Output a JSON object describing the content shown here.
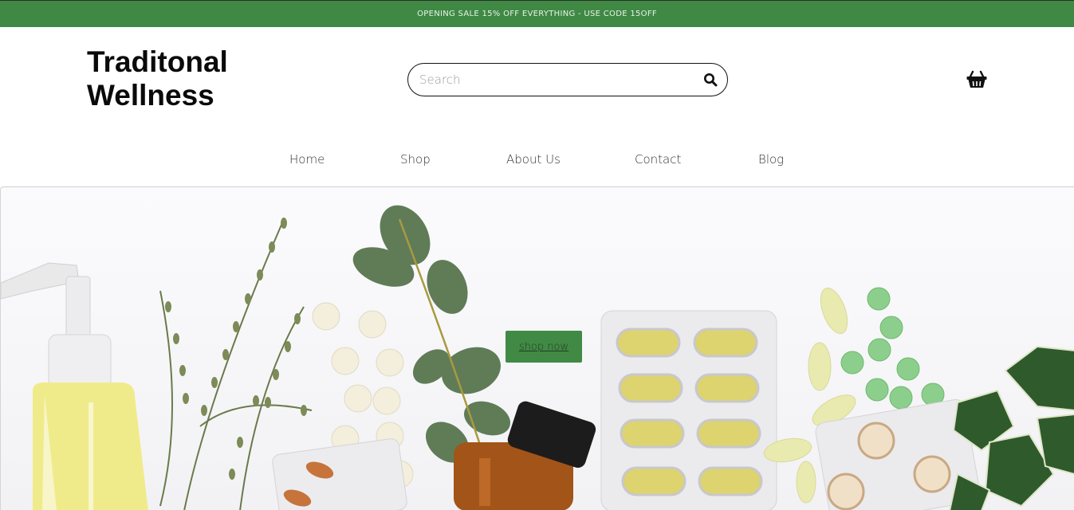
{
  "banner": {
    "text": "OPENING SALE 15% OFF EVERYTHING - USE CODE 15OFF"
  },
  "header": {
    "logo_line1": "Traditonal",
    "logo_line2": "Wellness"
  },
  "search": {
    "placeholder": "Search",
    "value": "",
    "icon": "search-icon"
  },
  "cart": {
    "icon": "basket-icon"
  },
  "nav": {
    "items": [
      {
        "label": "Home"
      },
      {
        "label": "Shop"
      },
      {
        "label": "About Us"
      },
      {
        "label": "Contact"
      },
      {
        "label": "Blog"
      }
    ]
  },
  "hero": {
    "cta_label": "shop now"
  },
  "colors": {
    "brand_green": "#3f8944",
    "button_green": "#418a45",
    "text_dark": "#0a0a0a"
  }
}
